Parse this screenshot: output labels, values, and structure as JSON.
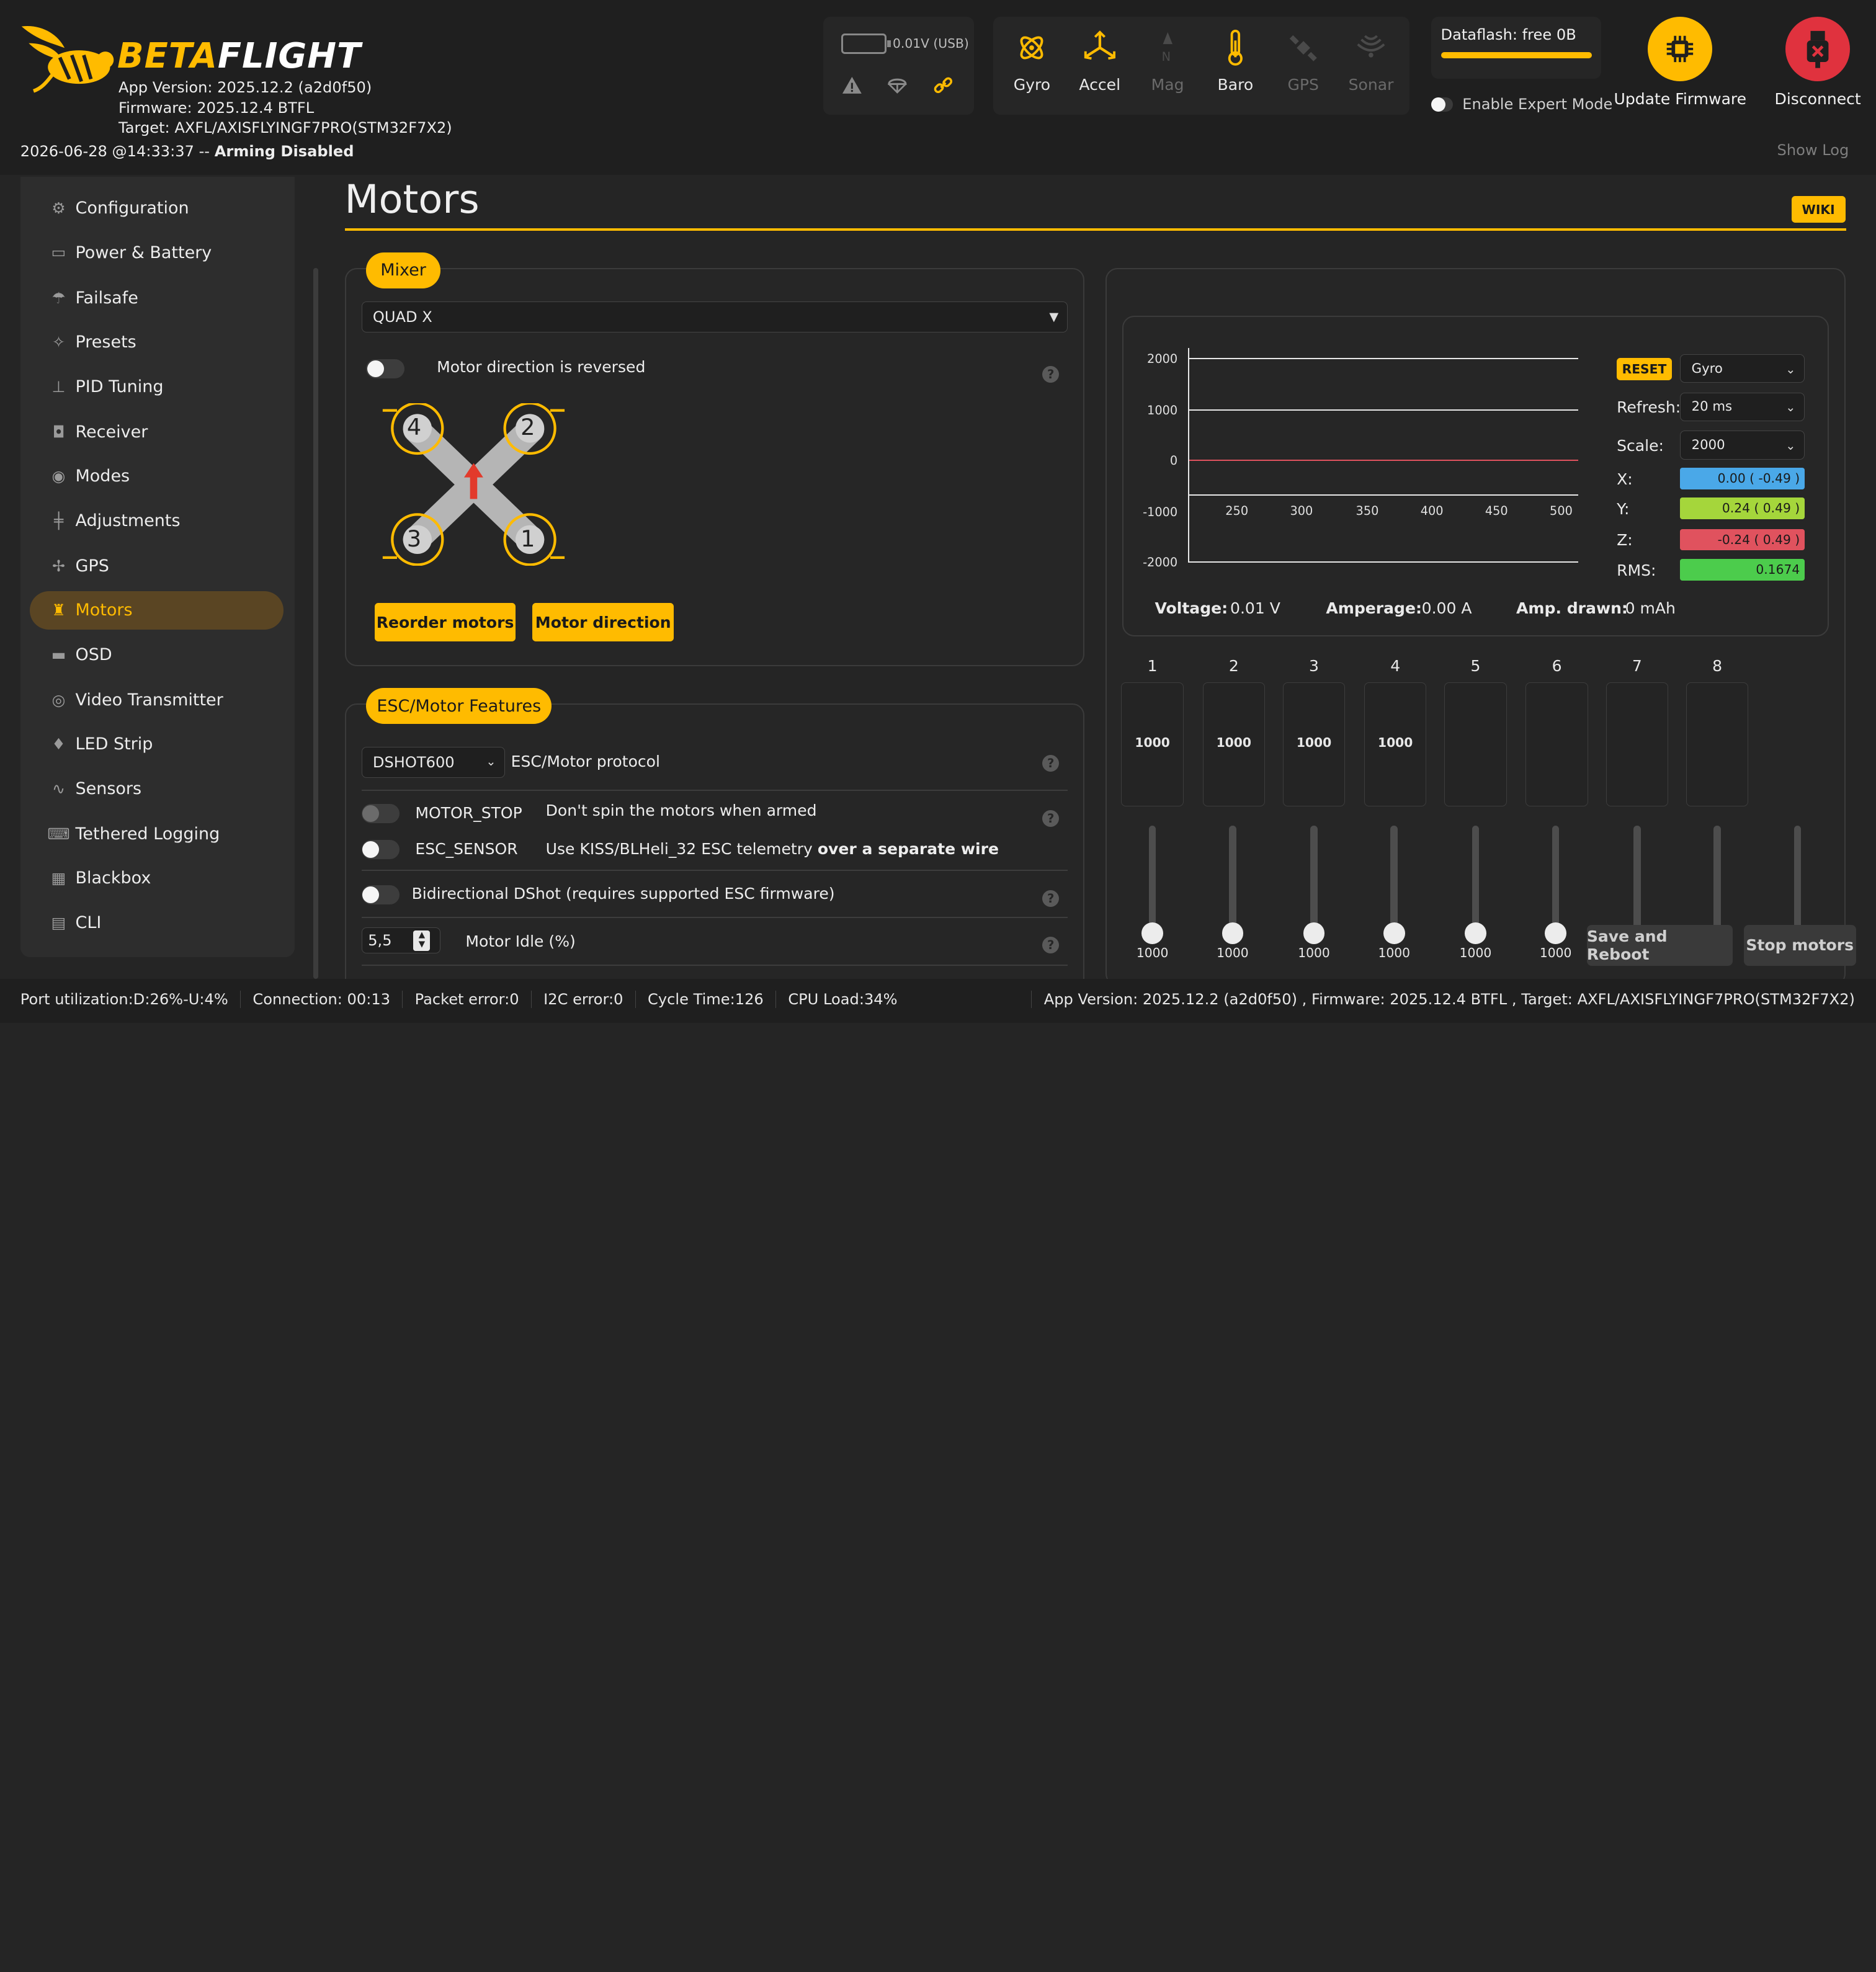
{
  "app": {
    "brand_beta": "BETA",
    "brand_flight": "FLIGHT",
    "app_version": "App Version: 2025.12.2 (a2d0f50)",
    "firmware": "Firmware: 2025.12.4 BTFL",
    "target": "Target: AXFL/AXISFLYINGF7PRO(STM32F7X2)",
    "status_time": "2026-06-28 @14:33:37 -- ",
    "status_state": "Arming Disabled"
  },
  "battery": {
    "voltage": "0.01V (USB)"
  },
  "sensors": [
    {
      "name": "Gyro",
      "active": true
    },
    {
      "name": "Accel",
      "active": true
    },
    {
      "name": "Mag",
      "active": false
    },
    {
      "name": "Baro",
      "active": true
    },
    {
      "name": "GPS",
      "active": false
    },
    {
      "name": "Sonar",
      "active": false
    }
  ],
  "dataflash": {
    "label": "Dataflash: free 0B"
  },
  "expert_mode": {
    "label": "Enable Expert Mode",
    "enabled": false
  },
  "header_buttons": {
    "update_firmware": "Update Firmware",
    "disconnect": "Disconnect",
    "show_log": "Show Log"
  },
  "colors": {
    "accent": "#ffbb00",
    "disconnect": "#e0323e",
    "sidebar_active": "#5a4523"
  },
  "sidebar": {
    "items": [
      {
        "label": "Configuration",
        "icon": "gear-icon"
      },
      {
        "label": "Power & Battery",
        "icon": "battery-icon"
      },
      {
        "label": "Failsafe",
        "icon": "parachute-icon"
      },
      {
        "label": "Presets",
        "icon": "wand-icon"
      },
      {
        "label": "PID Tuning",
        "icon": "sitemap-icon"
      },
      {
        "label": "Receiver",
        "icon": "robot-icon"
      },
      {
        "label": "Modes",
        "icon": "toggles-icon"
      },
      {
        "label": "Adjustments",
        "icon": "sliders-icon"
      },
      {
        "label": "GPS",
        "icon": "satellite-icon"
      },
      {
        "label": "Motors",
        "icon": "motor-icon",
        "active": true
      },
      {
        "label": "OSD",
        "icon": "osd-icon"
      },
      {
        "label": "Video Transmitter",
        "icon": "broadcast-icon"
      },
      {
        "label": "LED Strip",
        "icon": "led-icon"
      },
      {
        "label": "Sensors",
        "icon": "pulse-icon"
      },
      {
        "label": "Tethered Logging",
        "icon": "keyboard-icon"
      },
      {
        "label": "Blackbox",
        "icon": "blackbox-icon"
      },
      {
        "label": "CLI",
        "icon": "terminal-icon"
      }
    ]
  },
  "page": {
    "title": "Motors",
    "wiki": "WIKI"
  },
  "mixer": {
    "pill": "Mixer",
    "selected": "QUAD X",
    "reversed_label": "Motor direction is reversed",
    "reversed": false,
    "motor_labels": [
      "4",
      "2",
      "3",
      "1"
    ],
    "reorder_btn": "Reorder motors",
    "direction_btn": "Motor direction"
  },
  "esc": {
    "pill": "ESC/Motor Features",
    "protocol": "DSHOT600",
    "protocol_label": "ESC/Motor protocol",
    "motor_stop": "MOTOR_STOP",
    "motor_stop_desc": "Don't spin the motors when armed",
    "esc_sensor": "ESC_SENSOR",
    "esc_sensor_desc": "Use KISS/BLHeli_32 ESC telemetry ",
    "esc_sensor_desc_bold": "over a separate wire",
    "bidir": "Bidirectional DShot (requires supported ESC firmware)",
    "idle_value": "5,5",
    "idle_label": "Motor Idle (%)"
  },
  "graph": {
    "reset_btn": "RESET",
    "source": "Gyro",
    "refresh_label": "Refresh:",
    "refresh": "20 ms",
    "scale_label": "Scale:",
    "scale": "2000",
    "axes": [
      {
        "label": "X:",
        "value": "0.00 ( -0.49 )",
        "color": "#4aa8e8"
      },
      {
        "label": "Y:",
        "value": "0.24 ( 0.49 )",
        "color": "#a5d63b"
      },
      {
        "label": "Z:",
        "value": "-0.24 ( 0.49 )",
        "color": "#e0525e"
      },
      {
        "label": "RMS:",
        "value": "0.1674",
        "color": "#4ccc4c"
      }
    ],
    "y_ticks": [
      "2000",
      "1000",
      "0",
      "-1000",
      "-2000"
    ],
    "x_ticks": [
      "250",
      "300",
      "350",
      "400",
      "450",
      "500"
    ],
    "voltage_label": "Voltage:",
    "voltage": "0.01 V",
    "amperage_label": "Amperage:",
    "amperage": "0.00 A",
    "drawn_label": "Amp. drawn:",
    "drawn": "0 mAh"
  },
  "motors": {
    "numbers": [
      "1",
      "2",
      "3",
      "4",
      "5",
      "6",
      "7",
      "8"
    ],
    "values": [
      "1000",
      "1000",
      "1000",
      "1000",
      "",
      "",
      "",
      ""
    ],
    "slider_values": [
      "1000",
      "1000",
      "1000",
      "1000",
      "1000",
      "1000",
      "",
      ""
    ],
    "save_btn": "Save and Reboot",
    "stop_btn": "Stop motors"
  },
  "footer": {
    "port": "Port utilization:D:26%-U:4%",
    "connection": "Connection: 00:13",
    "packet": "Packet error:0",
    "i2c": "I2C error:0",
    "cycle": "Cycle Time:126",
    "cpu": "CPU Load:34%",
    "right": "App Version: 2025.12.2 (a2d0f50) , Firmware: 2025.12.4 BTFL , Target: AXFL/AXISFLYINGF7PRO(STM32F7X2)"
  }
}
